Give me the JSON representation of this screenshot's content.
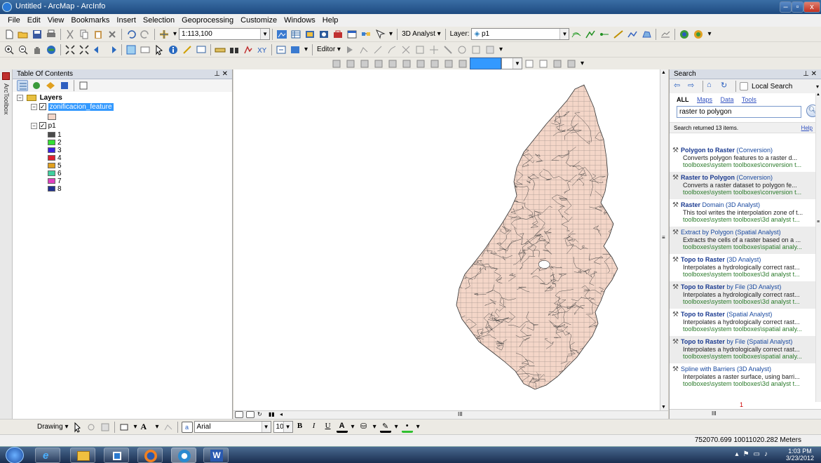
{
  "window": {
    "title": "Untitled - ArcMap - ArcInfo",
    "min": "–",
    "max": "▫",
    "close": "x"
  },
  "menu": [
    "File",
    "Edit",
    "View",
    "Bookmarks",
    "Insert",
    "Selection",
    "Geoprocessing",
    "Customize",
    "Windows",
    "Help"
  ],
  "toolbar": {
    "scale": "1:113,100",
    "analyst": "3D Analyst ▾",
    "layer_label": "Layer:",
    "layer_value": "p1",
    "editor": "Editor ▾"
  },
  "toc": {
    "title": "Table Of Contents",
    "pin": "⊥ ✕",
    "root": "Layers",
    "layer1": "zonificacion_feature",
    "layer2": "p1",
    "classes": [
      {
        "label": "1",
        "color": "#4a4a4a"
      },
      {
        "label": "2",
        "color": "#33e033"
      },
      {
        "label": "3",
        "color": "#3a20e0"
      },
      {
        "label": "4",
        "color": "#e02030"
      },
      {
        "label": "5",
        "color": "#e0a020"
      },
      {
        "label": "6",
        "color": "#40d0a0"
      },
      {
        "label": "7",
        "color": "#e040c0"
      },
      {
        "label": "8",
        "color": "#203090"
      }
    ],
    "feature_color": "#f4d6c8"
  },
  "side_tab": "ArcToolbox",
  "search": {
    "title": "Search",
    "pin": "⊥ ✕",
    "scope": "Local Search",
    "filters": {
      "all": "ALL",
      "maps": "Maps",
      "data": "Data",
      "tools": "Tools"
    },
    "query": "raster to polygon",
    "count_text": "Search returned 13 items.",
    "help": "Help",
    "results": [
      {
        "title_bold": "Polygon to Raster",
        "title_rest": " (Conversion)",
        "desc": "Converts polygon features to a raster d...",
        "path": "toolboxes\\system toolboxes\\conversion t..."
      },
      {
        "title_bold": "Raster to Polygon",
        "title_rest": " (Conversion)",
        "desc": "Converts a raster dataset to polygon fe...",
        "path": "toolboxes\\system toolboxes\\conversion t..."
      },
      {
        "title_bold": "Raster",
        "title_rest": " Domain (3D Analyst)",
        "desc": "This tool writes the interpolation zone of t...",
        "path": "toolboxes\\system toolboxes\\3d analyst t..."
      },
      {
        "title_bold": "",
        "title_rest": "Extract by Polygon (Spatial Analyst)",
        "desc": "Extracts the cells of a raster based on a ...",
        "path": "toolboxes\\system toolboxes\\spatial analy..."
      },
      {
        "title_bold": "Topo to Raster",
        "title_rest": " (3D Analyst)",
        "desc": "Interpolates a hydrologically correct rast...",
        "path": "toolboxes\\system toolboxes\\3d analyst t..."
      },
      {
        "title_bold": "Topo to Raster",
        "title_rest": " by File (3D Analyst)",
        "desc": "Interpolates a hydrologically correct rast...",
        "path": "toolboxes\\system toolboxes\\3d analyst t..."
      },
      {
        "title_bold": "Topo to Raster",
        "title_rest": " (Spatial Analyst)",
        "desc": "Interpolates a hydrologically correct rast...",
        "path": "toolboxes\\system toolboxes\\spatial analy..."
      },
      {
        "title_bold": "Topo to Raster",
        "title_rest": " by File (Spatial Analyst)",
        "desc": "Interpolates a hydrologically correct rast...",
        "path": "toolboxes\\system toolboxes\\spatial analy..."
      },
      {
        "title_bold": "",
        "title_rest": "Spline with Barriers (3D Analyst)",
        "desc": "Interpolates a raster surface, using barri...",
        "path": "toolboxes\\system toolboxes\\3d analyst t..."
      }
    ],
    "footer_num": "1"
  },
  "drawing": {
    "label": "Drawing ▾",
    "font": "Arial",
    "size": "10"
  },
  "status": {
    "coords": "752070.699  10011020.282 Meters"
  },
  "clock": {
    "time": "1:03 PM",
    "date": "3/23/2012"
  },
  "colors": {
    "accent": "#3399ff",
    "map_fill": "#f4d6c8",
    "map_line": "#3a3a3a"
  }
}
